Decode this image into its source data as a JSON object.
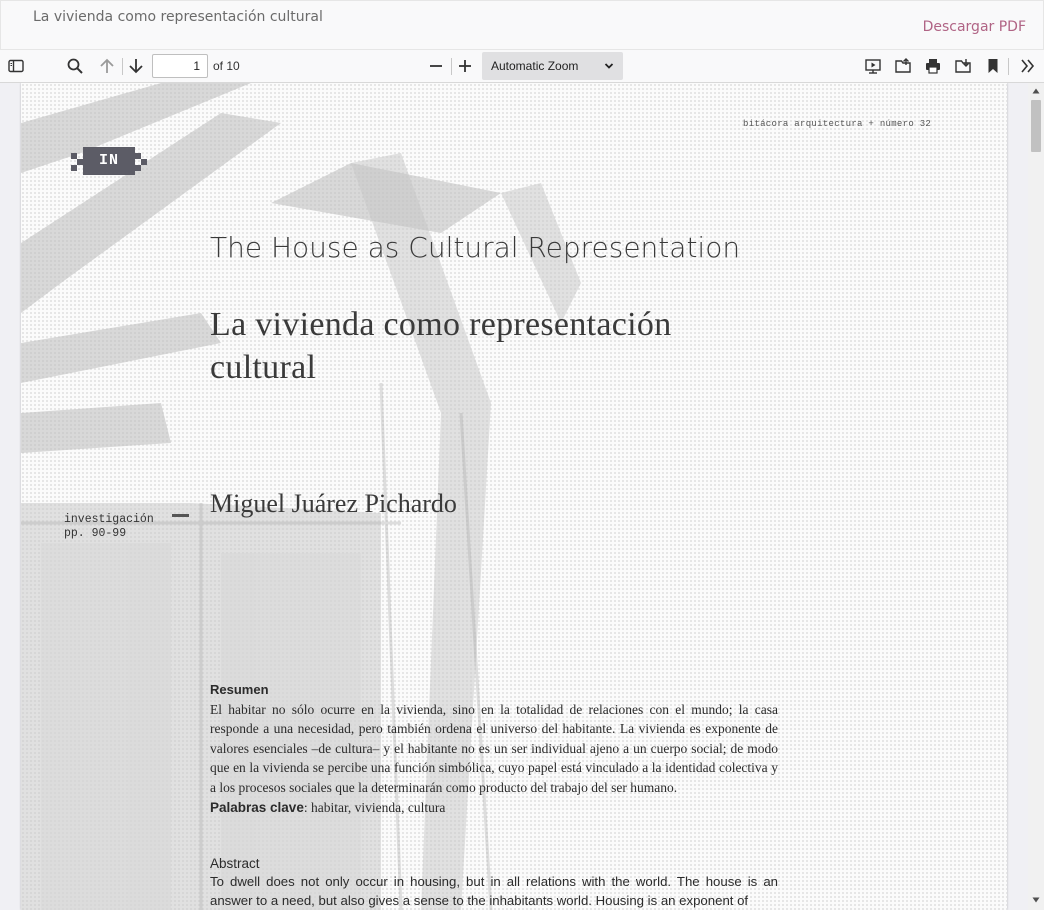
{
  "header": {
    "title": "La vivienda como representación cultural",
    "download_label": "Descargar PDF"
  },
  "toolbar": {
    "page_number": "1",
    "page_count_label": "of 10",
    "zoom_label": "Automatic Zoom",
    "icons": [
      "sidebar-toggle-icon",
      "search-icon",
      "arrow-up-icon",
      "arrow-down-icon",
      "zoom-out-icon",
      "zoom-in-icon",
      "presentation-icon",
      "open-file-icon",
      "print-icon",
      "download-icon",
      "bookmark-icon",
      "tools-icon"
    ]
  },
  "document": {
    "journal_header": "bitácora arquitectura + número 32",
    "badge": "IN",
    "title_en": "The House as Cultural Representation",
    "title_es": "La vivienda como representación cultural",
    "section_label": "investigación\npp. 90-99",
    "author": "Miguel Juárez Pichardo",
    "resumen_heading": "Resumen",
    "resumen_body": "El habitar no sólo ocurre en la vivienda, sino en la totalidad de relaciones con el mundo; la casa responde a una necesidad, pero también ordena el universo del habitante. La vivienda es exponente de valores esenciales –de cultura– y el habitante no es un ser individual ajeno a un cuerpo social; de modo que en la vivienda se percibe una función simbólica, cuyo papel está vinculado a la identidad colectiva y a los procesos sociales que la determinarán como producto del trabajo del ser humano.",
    "keywords_label": "Palabras clave",
    "keywords": ": habitar, vivienda, cultura",
    "abstract_heading": "Abstract",
    "abstract_body": "To dwell does not only occur in housing, but in all relations with the world. The house is an answer to a need, but also gives a sense to the inhabitants world. Housing is an exponent of"
  },
  "colors": {
    "accent": "#b06485",
    "toolbar_bg": "#f9f9fa",
    "badge_bg": "#5c5c66"
  }
}
